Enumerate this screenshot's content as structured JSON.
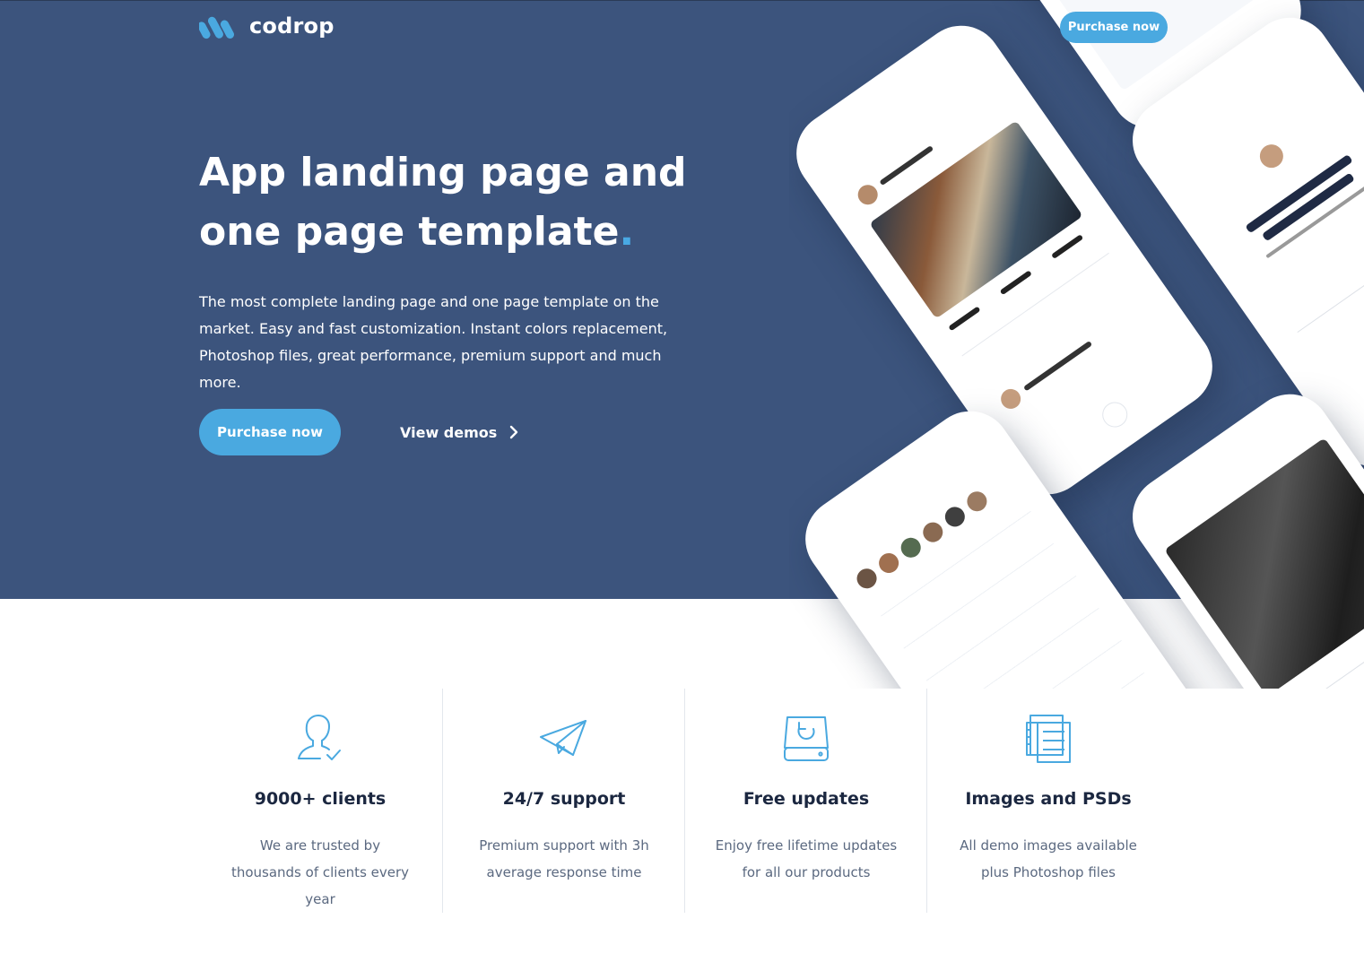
{
  "brand": {
    "name": "codrop"
  },
  "header": {
    "cta_label": "Purchase now"
  },
  "hero": {
    "title_line1": "App landing page and",
    "title_line2": "one page template",
    "title_dot": ".",
    "subtitle": "The most complete landing page and one page template on the market. Easy and fast customization. Instant colors replacement, Photoshop files, great performance, premium support and much more.",
    "primary_button": "Purchase now",
    "secondary_link": "View demos"
  },
  "features": [
    {
      "icon": "user-check-icon",
      "title": "9000+ clients",
      "desc": "We are trusted by thousands of clients every year"
    },
    {
      "icon": "paper-plane-icon",
      "title": "24/7 support",
      "desc": "Premium support with 3h average response time"
    },
    {
      "icon": "drive-refresh-icon",
      "title": "Free updates",
      "desc": "Enjoy free lifetime updates for all our products"
    },
    {
      "icon": "documents-icon",
      "title": "Images and PSDs",
      "desc": "All demo images available plus Photoshop files"
    }
  ],
  "colors": {
    "hero_bg": "#3c547d",
    "accent": "#4aa9e0",
    "text_dark": "#1b2740",
    "text_muted": "#5b6980"
  }
}
